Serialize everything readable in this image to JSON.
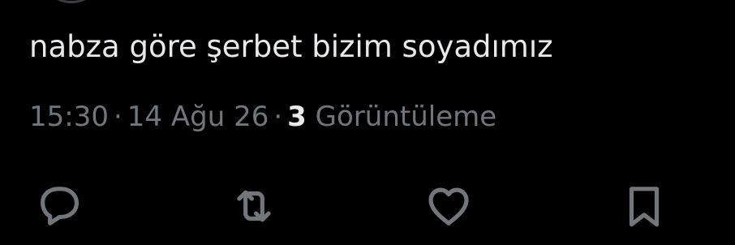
{
  "tweet": {
    "text": "nabza göre şerbet bizim soyadımız",
    "time": "15:30",
    "date": "14 Ağu 26",
    "separator": "·",
    "views_count": "3",
    "views_label": "Görüntüleme"
  },
  "actions": {
    "reply": "reply-icon",
    "retweet": "retweet-icon",
    "like": "heart-icon",
    "bookmark": "bookmark-icon"
  },
  "colors": {
    "background": "#000000",
    "text": "#e7e9ea",
    "secondary": "#71767b"
  }
}
